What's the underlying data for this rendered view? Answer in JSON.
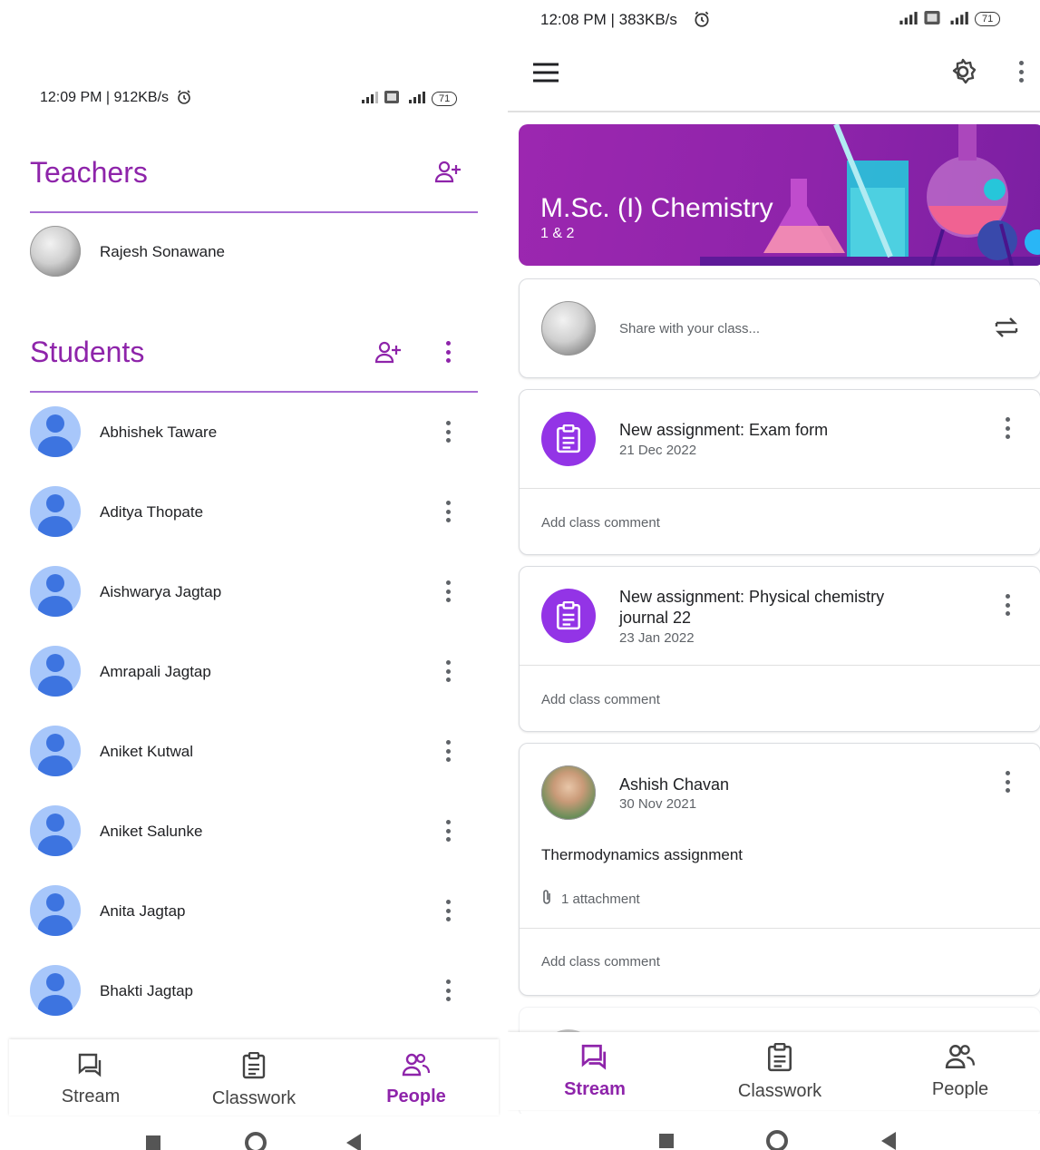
{
  "left": {
    "status": {
      "time": "12:09 PM | 912KB/s",
      "battery": "71"
    },
    "teachers": {
      "title": "Teachers",
      "items": [
        {
          "name": "Rajesh Sonawane"
        }
      ]
    },
    "students": {
      "title": "Students",
      "items": [
        {
          "name": "Abhishek Taware"
        },
        {
          "name": "Aditya Thopate"
        },
        {
          "name": "Aishwarya Jagtap"
        },
        {
          "name": "Amrapali Jagtap"
        },
        {
          "name": "Aniket Kutwal"
        },
        {
          "name": "Aniket Salunke"
        },
        {
          "name": "Anita Jagtap"
        },
        {
          "name": "Bhakti Jagtap"
        }
      ]
    },
    "bottom_nav": {
      "stream": "Stream",
      "classwork": "Classwork",
      "people": "People",
      "active": "People"
    }
  },
  "right": {
    "status": {
      "time": "12:08 PM | 383KB/s",
      "battery": "71"
    },
    "class_banner": {
      "title": "M.Sc. (I) Chemistry",
      "subtitle": "1 & 2"
    },
    "share": {
      "placeholder": "Share with your class..."
    },
    "posts": [
      {
        "type": "assignment",
        "title": "New assignment: Exam form",
        "date": "21 Dec 2022",
        "comment": "Add class comment"
      },
      {
        "type": "assignment",
        "title_line1": "New assignment: Physical chemistry",
        "title_line2": "journal 22",
        "date": "23 Jan 2022",
        "comment": "Add class comment"
      },
      {
        "type": "announcement",
        "author": "Ashish Chavan",
        "date": "30 Nov 2021",
        "text": "Thermodynamics assignment",
        "attachments": "1 attachment",
        "comment": "Add class comment"
      }
    ],
    "bottom_nav": {
      "stream": "Stream",
      "classwork": "Classwork",
      "people": "People",
      "active": "Stream"
    }
  },
  "colors": {
    "accent": "#8e24aa",
    "assignment_icon": "#9334e6",
    "student_avatar": "#a8c7fa",
    "student_avatar_fg": "#3d74e0"
  }
}
